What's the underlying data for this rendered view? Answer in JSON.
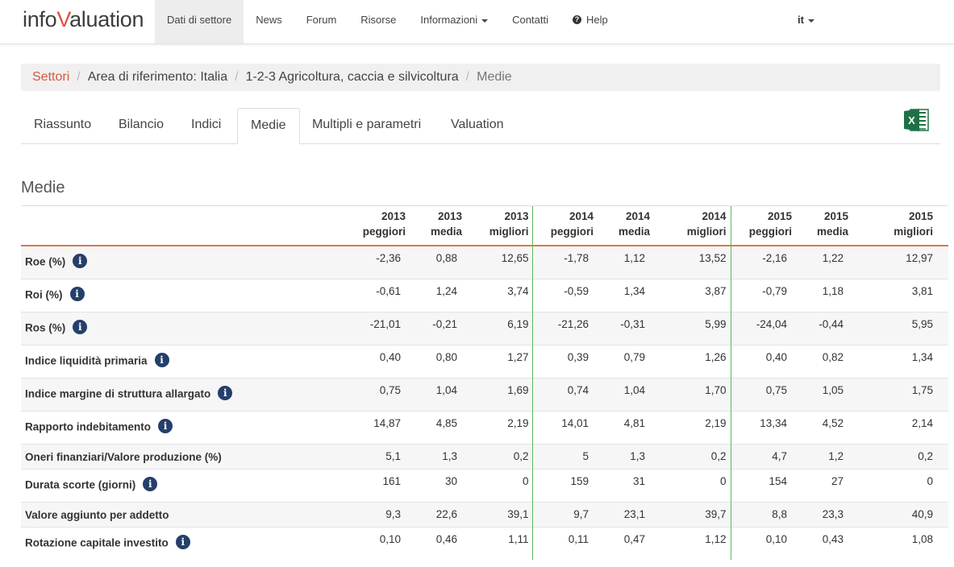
{
  "brand": {
    "part1": "info",
    "part2": "V",
    "part3": "aluation"
  },
  "nav": {
    "items": [
      {
        "label": "Dati di settore"
      },
      {
        "label": "News"
      },
      {
        "label": "Forum"
      },
      {
        "label": "Risorse"
      },
      {
        "label": "Informazioni"
      },
      {
        "label": "Contatti"
      },
      {
        "label": "Help"
      }
    ],
    "help_icon": "?",
    "language": "it"
  },
  "breadcrumb": {
    "items": [
      "Settori",
      "Area di riferimento: Italia",
      "1-2-3 Agricoltura, caccia e silvicoltura",
      "Medie"
    ],
    "separator": "/"
  },
  "tabs": [
    "Riassunto",
    "Bilancio",
    "Indici",
    "Medie",
    "Multipli e parametri",
    "Valuation"
  ],
  "active_tab": "Medie",
  "excel_icon": "excel-icon",
  "section_title": "Medie",
  "table": {
    "headers": [
      [
        "2013",
        "peggiori"
      ],
      [
        "2013",
        "media"
      ],
      [
        "2013",
        "migliori"
      ],
      [
        "2014",
        "peggiori"
      ],
      [
        "2014",
        "media"
      ],
      [
        "2014",
        "migliori"
      ],
      [
        "2015",
        "peggiori"
      ],
      [
        "2015",
        "media"
      ],
      [
        "2015",
        "migliori"
      ]
    ],
    "info_glyph": "i",
    "rows": [
      {
        "label": "Roe (%)",
        "values": [
          "-2,36",
          "0,88",
          "12,65",
          "-1,78",
          "1,12",
          "13,52",
          "-2,16",
          "1,22",
          "12,97"
        ]
      },
      {
        "label": "Roi (%)",
        "values": [
          "-0,61",
          "1,24",
          "3,74",
          "-0,59",
          "1,34",
          "3,87",
          "-0,79",
          "1,18",
          "3,81"
        ]
      },
      {
        "label": "Ros (%)",
        "values": [
          "-21,01",
          "-0,21",
          "6,19",
          "-21,26",
          "-0,31",
          "5,99",
          "-24,04",
          "-0,44",
          "5,95"
        ]
      },
      {
        "label": "Indice liquidità primaria",
        "values": [
          "0,40",
          "0,80",
          "1,27",
          "0,39",
          "0,79",
          "1,26",
          "0,40",
          "0,82",
          "1,34"
        ]
      },
      {
        "label": "Indice margine di struttura allargato",
        "values": [
          "0,75",
          "1,04",
          "1,69",
          "0,74",
          "1,04",
          "1,70",
          "0,75",
          "1,05",
          "1,75"
        ]
      },
      {
        "label": "Rapporto indebitamento",
        "values": [
          "14,87",
          "4,85",
          "2,19",
          "14,01",
          "4,81",
          "2,19",
          "13,34",
          "4,52",
          "2,14"
        ]
      },
      {
        "label": "Oneri finanziari/Valore produzione (%)",
        "values": [
          "5,1",
          "1,3",
          "0,2",
          "5",
          "1,3",
          "0,2",
          "4,7",
          "1,2",
          "0,2"
        ]
      },
      {
        "label": "Durata scorte (giorni)",
        "values": [
          "161",
          "30",
          "0",
          "159",
          "31",
          "0",
          "154",
          "27",
          "0"
        ]
      },
      {
        "label": "Valore aggiunto per addetto",
        "values": [
          "9,3",
          "22,6",
          "39,1",
          "9,7",
          "23,1",
          "39,7",
          "8,8",
          "23,3",
          "40,9"
        ]
      },
      {
        "label": "Rotazione capitale investito",
        "values": [
          "0,10",
          "0,46",
          "1,11",
          "0,11",
          "0,47",
          "1,12",
          "0,10",
          "0,43",
          "1,08"
        ]
      }
    ]
  }
}
